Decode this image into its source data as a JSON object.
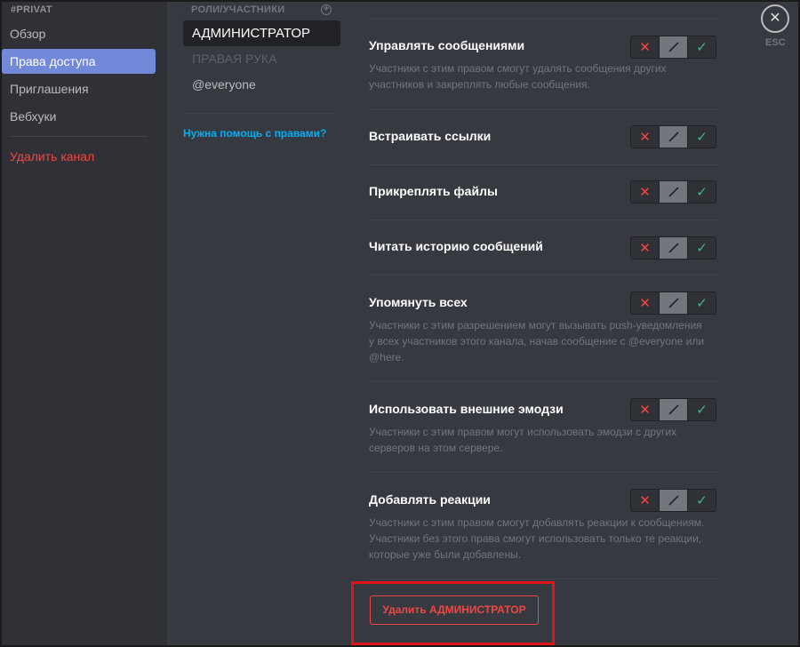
{
  "nav": {
    "header": "PRIVAT",
    "items": [
      {
        "label": "Обзор"
      },
      {
        "label": "Права доступа"
      },
      {
        "label": "Приглашения"
      },
      {
        "label": "Вебхуки"
      }
    ],
    "delete_label": "Удалить канал"
  },
  "roles": {
    "header": "РОЛИ/УЧАСТНИКИ",
    "items": [
      {
        "label": "АДМИНИСТРАТОР"
      },
      {
        "label": "ПРАВАЯ РУКА"
      },
      {
        "label": "@everyone"
      }
    ],
    "help_link": "Нужна помощь с правами?"
  },
  "permissions": [
    {
      "title": "Управлять сообщениями",
      "desc": "Участники с этим правом смогут удалять сообщения других участников и закреплять любые сообщения.",
      "state": "neutral"
    },
    {
      "title": "Встраивать ссылки",
      "desc": "",
      "state": "neutral"
    },
    {
      "title": "Прикреплять файлы",
      "desc": "",
      "state": "neutral"
    },
    {
      "title": "Читать историю сообщений",
      "desc": "",
      "state": "neutral"
    },
    {
      "title": "Упомянуть всех",
      "desc": "Участники с этим разрешением могут вызывать push-уведомления у всех участников этого канала, начав сообщение с @everyone или @here.",
      "state": "neutral"
    },
    {
      "title": "Использовать внешние эмодзи",
      "desc": "Участники с этим правом могут использовать эмодзи с других серверов на этом сервере.",
      "state": "neutral"
    },
    {
      "title": "Добавлять реакции",
      "desc": "Участники с этим правом смогут добавлять реакции к сообщениям. Участники без этого права смогут использовать только те реакции, которые уже были добавлены.",
      "state": "neutral"
    }
  ],
  "tri_icons": {
    "deny": "✕",
    "allow": "✓"
  },
  "delete_role_button": "Удалить АДМИНИСТРАТОР",
  "close": {
    "icon": "✕",
    "label": "ESC"
  }
}
